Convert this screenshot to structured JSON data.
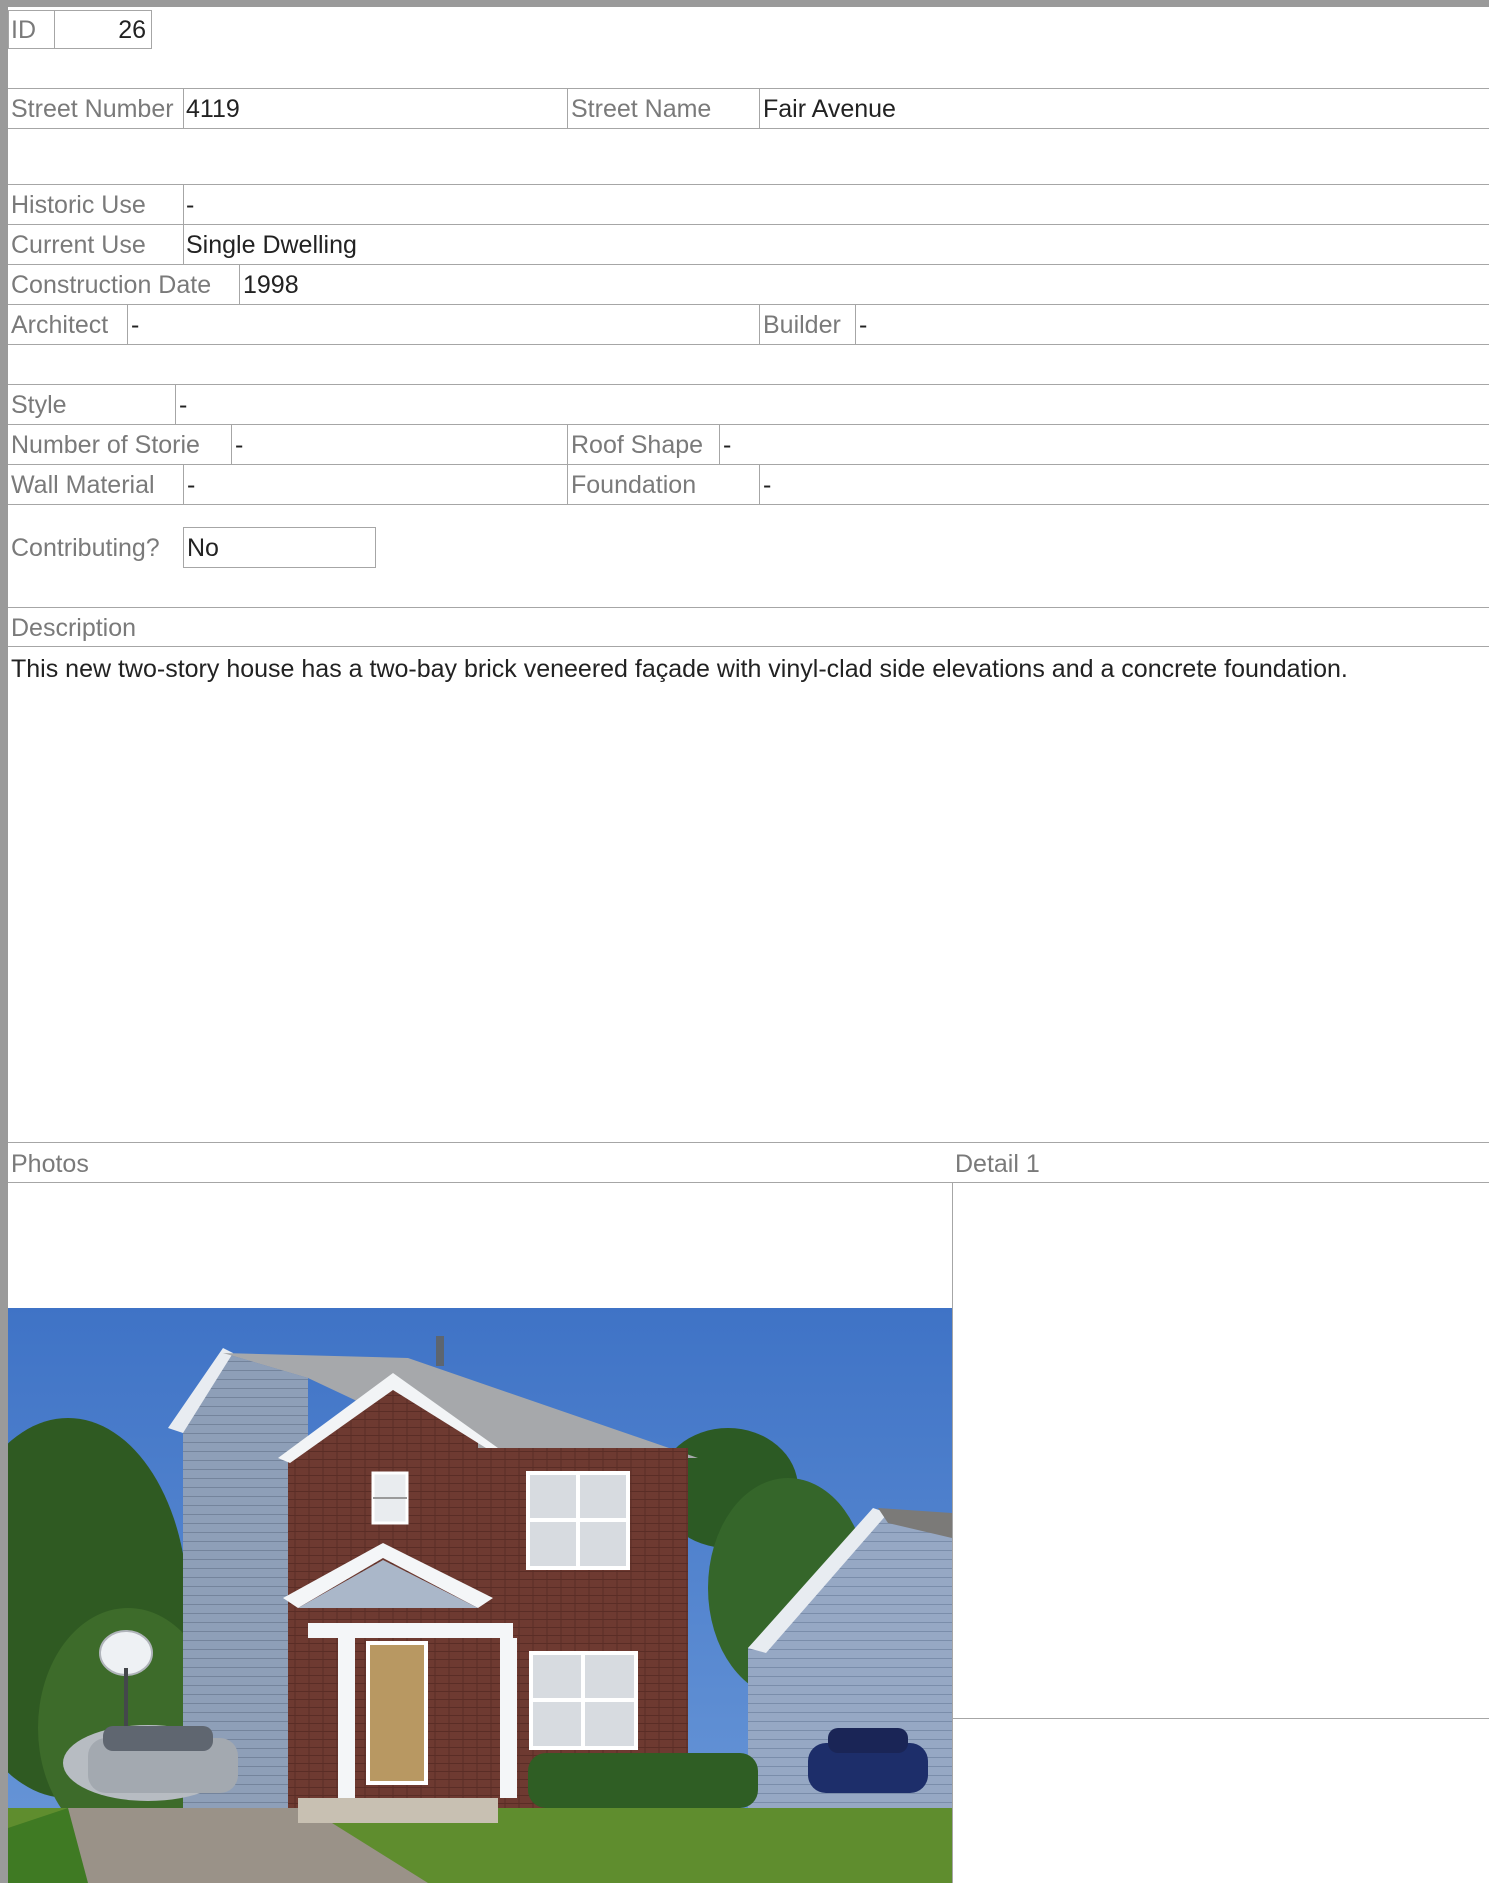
{
  "record": {
    "id_label": "ID",
    "id_value": "26",
    "street_number_label": "Street Number",
    "street_number_value": "4119",
    "street_name_label": "Street Name",
    "street_name_value": "Fair Avenue",
    "historic_use_label": "Historic Use",
    "historic_use_value": "-",
    "current_use_label": "Current Use",
    "current_use_value": "Single Dwelling",
    "construction_date_label": "Construction Date",
    "construction_date_value": "1998",
    "architect_label": "Architect",
    "architect_value": "-",
    "builder_label": "Builder",
    "builder_value": "-",
    "style_label": "Style",
    "style_value": "-",
    "stories_label": "Number of Storie",
    "stories_value": "-",
    "roof_label": "Roof Shape",
    "roof_value": "-",
    "wall_label": "Wall Material",
    "wall_value": "-",
    "foundation_label": "Foundation",
    "foundation_value": "-",
    "contributing_label": "Contributing?",
    "contributing_value": "No",
    "description_label": "Description",
    "description_text": "This new two-story house has a two-bay brick veneered façade with vinyl-clad side elevations and a concrete foundation.",
    "photos_label": "Photos",
    "detail_label": "Detail 1"
  },
  "colors": {
    "frame": "#9a9a9a",
    "rule": "#a6a6a6",
    "label_text": "#7a7a7a",
    "value_text": "#222222"
  }
}
